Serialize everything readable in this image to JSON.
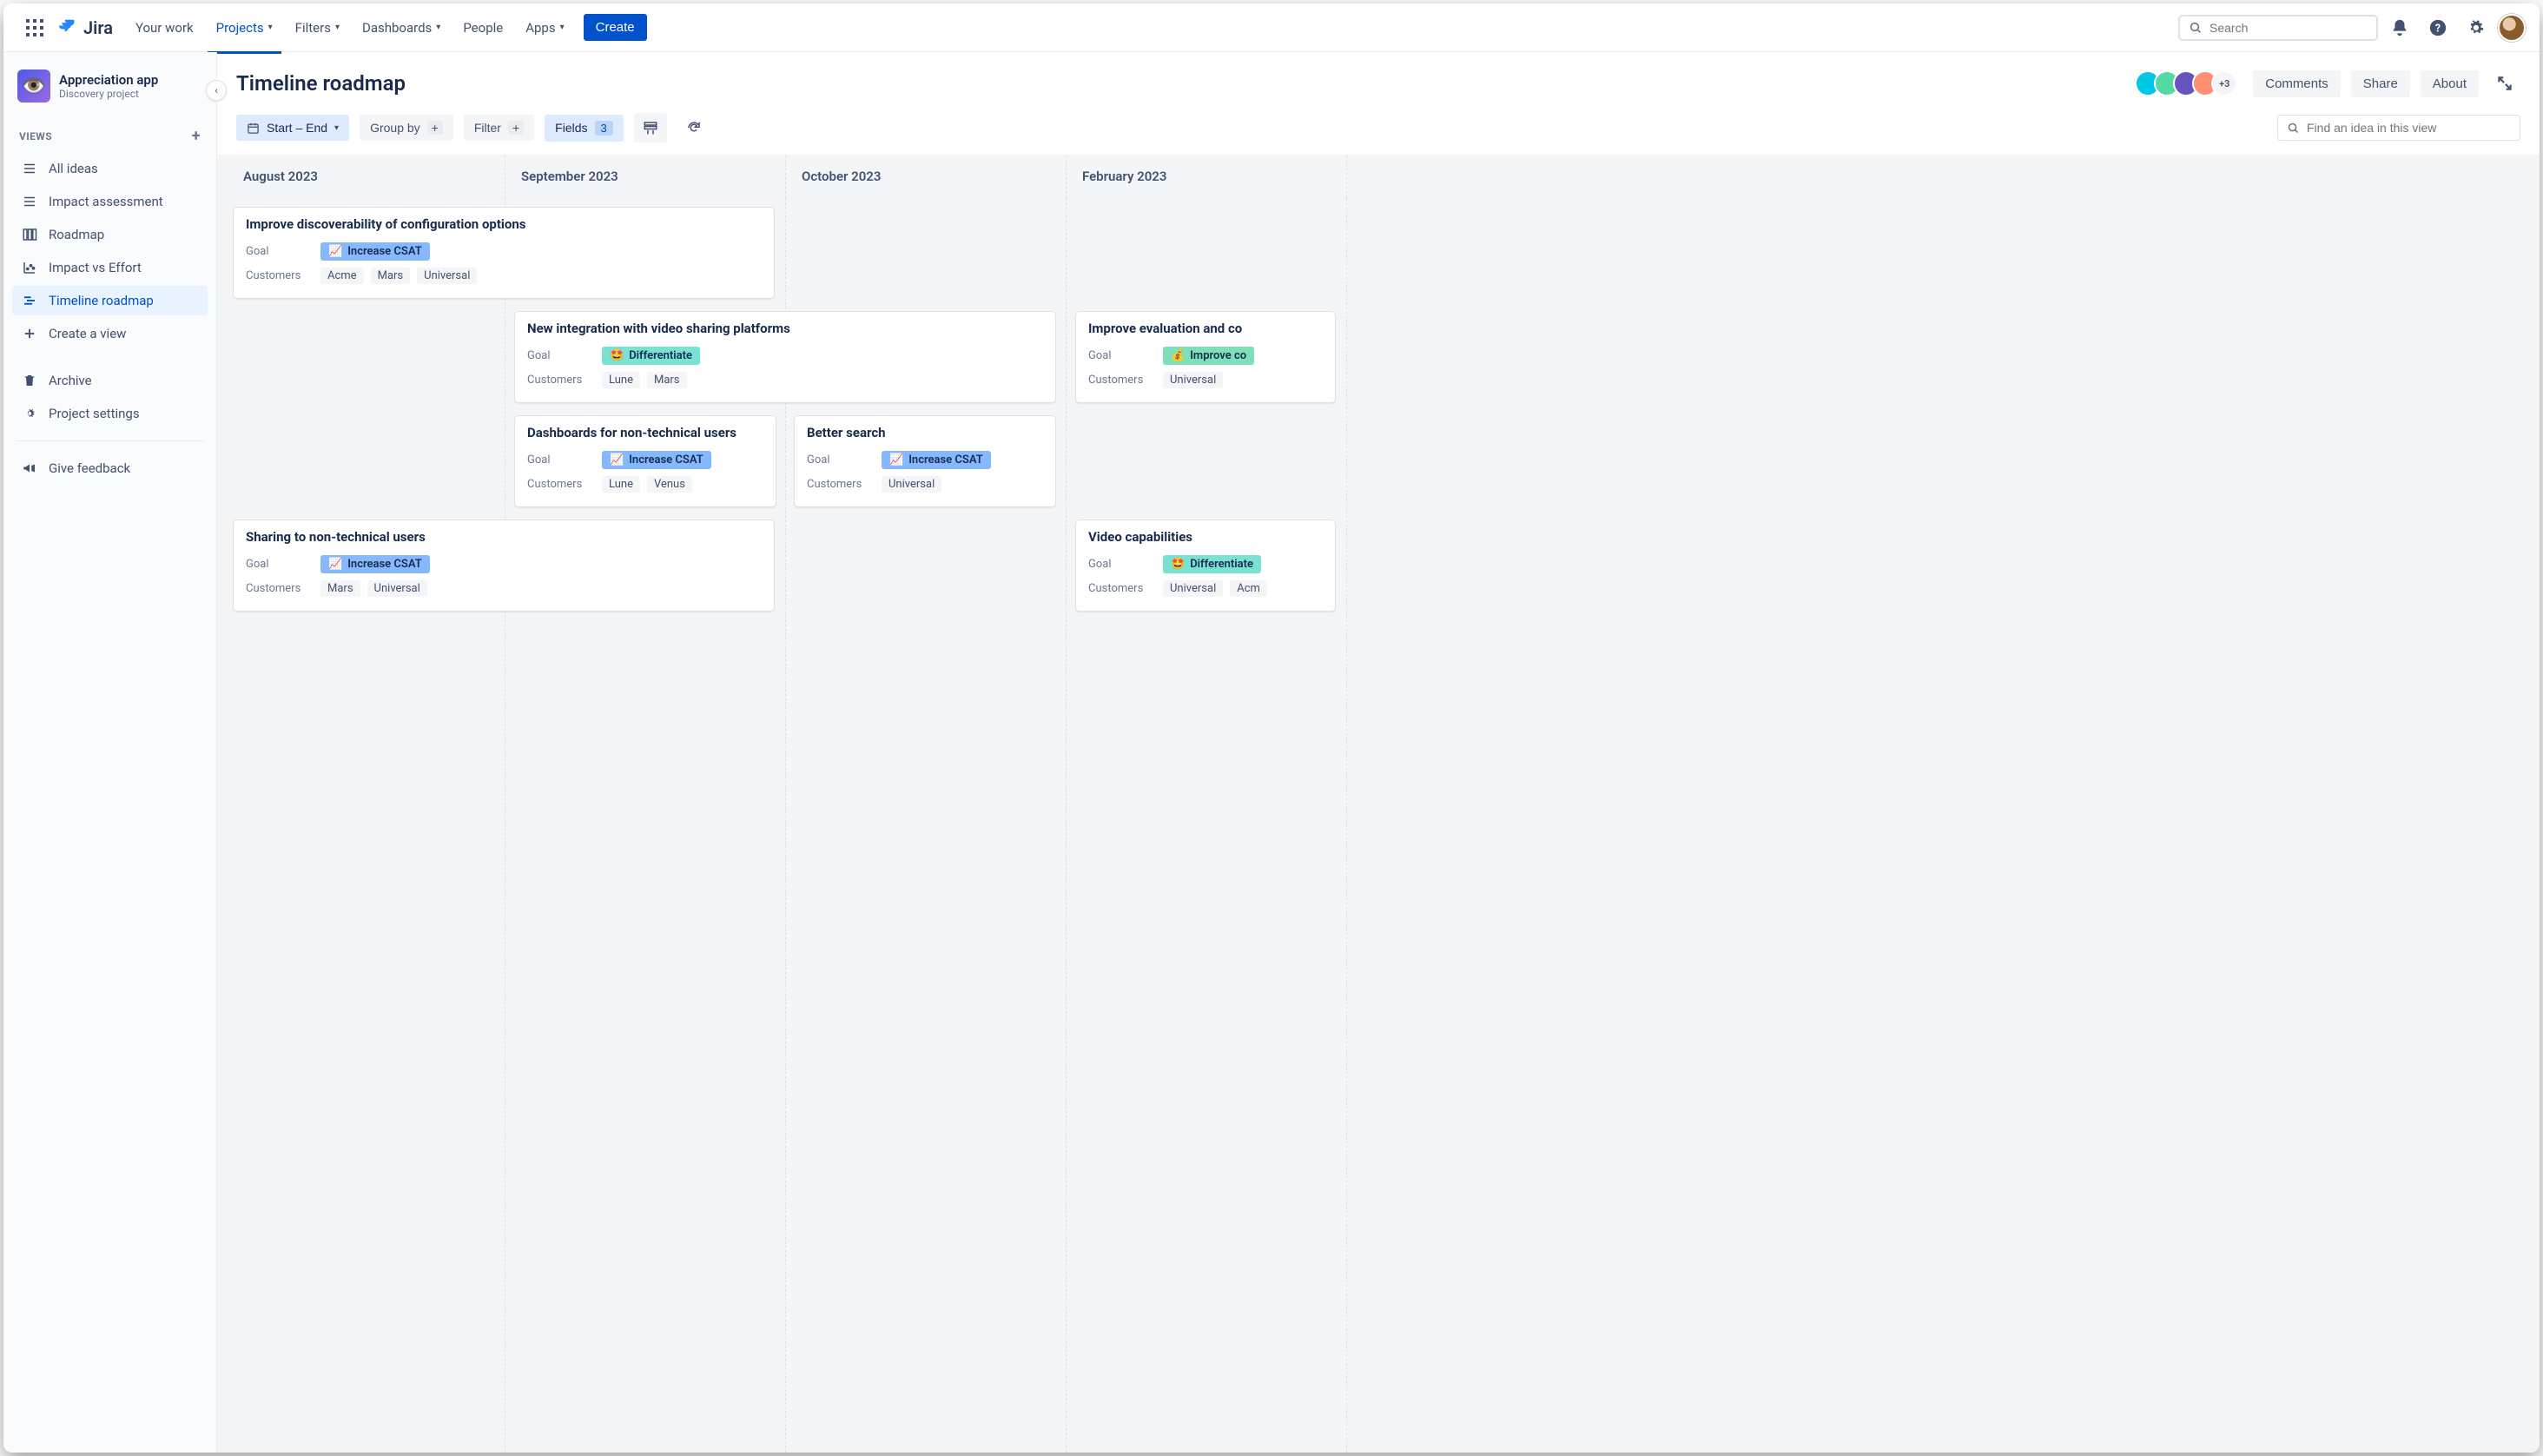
{
  "topnav": {
    "logo": "Jira",
    "items": [
      "Your work",
      "Projects",
      "Filters",
      "Dashboards",
      "People",
      "Apps"
    ],
    "active_idx": 1,
    "create": "Create",
    "search_placeholder": "Search"
  },
  "project": {
    "name": "Appreciation app",
    "subtitle": "Discovery project"
  },
  "sidebar": {
    "section": "VIEWS",
    "items": [
      {
        "label": "All ideas",
        "icon": "list"
      },
      {
        "label": "Impact assessment",
        "icon": "list"
      },
      {
        "label": "Roadmap",
        "icon": "board"
      },
      {
        "label": "Impact vs Effort",
        "icon": "chart"
      },
      {
        "label": "Timeline roadmap",
        "icon": "timeline",
        "selected": true
      },
      {
        "label": "Create a view",
        "icon": "plus"
      }
    ],
    "archive": "Archive",
    "settings": "Project settings",
    "feedback": "Give feedback"
  },
  "page": {
    "title": "Timeline roadmap",
    "avatar_overflow": "+3",
    "buttons": [
      "Comments",
      "Share",
      "About"
    ]
  },
  "toolbar": {
    "date": "Start – End",
    "group": "Group by",
    "filter": "Filter",
    "fields": "Fields",
    "fields_count": "3",
    "find_placeholder": "Find an idea in this view"
  },
  "months": [
    "August 2023",
    "September 2023",
    "October 2023",
    "February 2023"
  ],
  "field_labels": {
    "goal": "Goal",
    "customers": "Customers"
  },
  "goals": {
    "csat": {
      "emoji": "📈",
      "text": "Increase CSAT"
    },
    "diff": {
      "emoji": "🤩",
      "text": "Differentiate"
    },
    "cost": {
      "emoji": "💰",
      "text": "Improve co"
    }
  },
  "cards": {
    "c1": {
      "title": "Improve discoverability of configuration options",
      "goal": "csat",
      "customers": [
        "Acme",
        "Mars",
        "Universal"
      ]
    },
    "c2": {
      "title": "New integration with video sharing platforms",
      "goal": "diff",
      "customers": [
        "Lune",
        "Mars"
      ]
    },
    "c3": {
      "title": "Improve evaluation and co",
      "goal": "cost",
      "customers": [
        "Universal"
      ]
    },
    "c4": {
      "title": "Dashboards for non-technical users",
      "goal": "csat",
      "customers": [
        "Lune",
        "Venus"
      ]
    },
    "c5": {
      "title": "Better search",
      "goal": "csat",
      "customers": [
        "Universal"
      ]
    },
    "c6": {
      "title": "Sharing to non-technical users",
      "goal": "csat",
      "customers": [
        "Mars",
        "Universal"
      ]
    },
    "c7": {
      "title": "Video capabilities",
      "goal": "diff",
      "customers": [
        "Universal",
        "Acm"
      ]
    }
  }
}
